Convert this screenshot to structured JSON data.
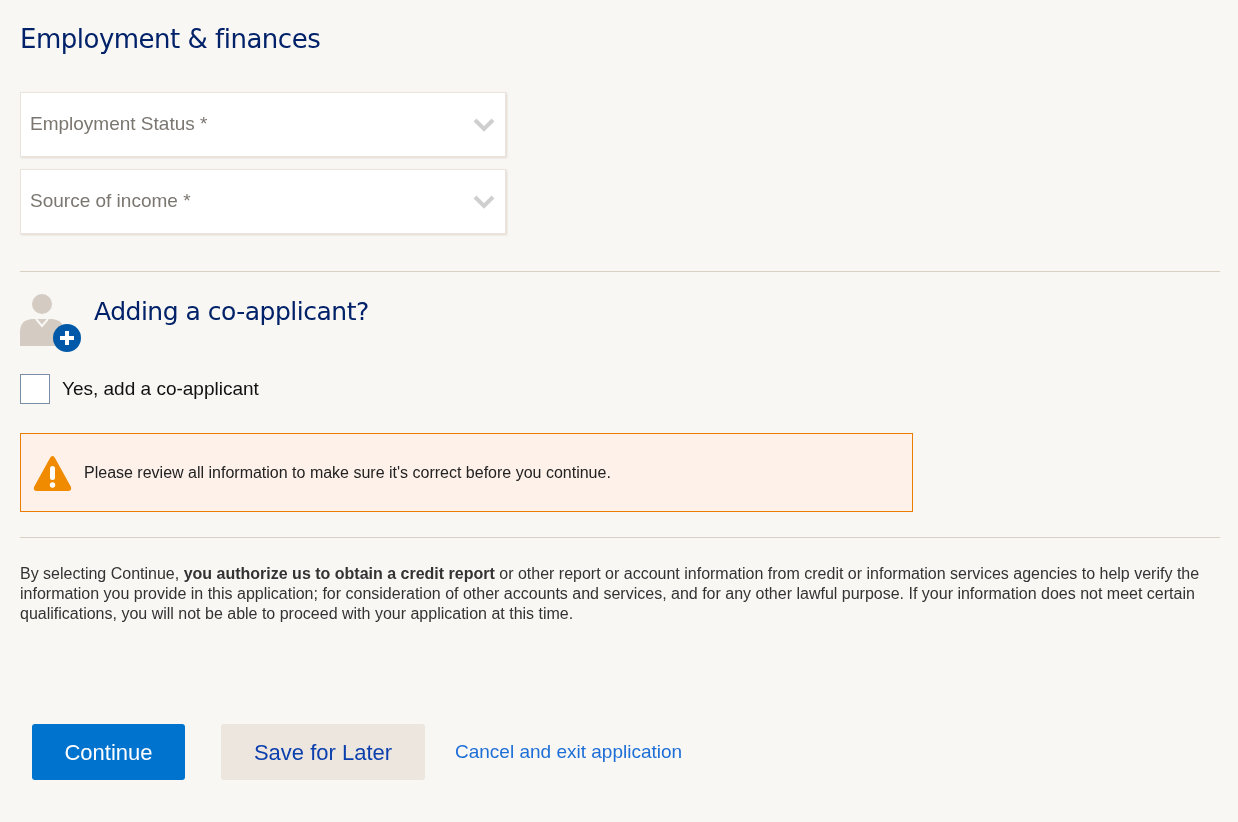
{
  "heading": "Employment & finances",
  "selects": [
    {
      "placeholder": "Employment Status *"
    },
    {
      "placeholder": "Source of income *"
    }
  ],
  "co_applicant": {
    "heading": "Adding a co-applicant?",
    "checkbox": {
      "label": "Yes, add a co-applicant",
      "checked": false
    }
  },
  "alert": {
    "message": "Please review all information to make sure it's correct before you continue."
  },
  "disclaimer": "By selecting Continue, **you authorize us to obtain a credit report** or other report or account information from credit or information services agencies to help verify the information you provide in this application; for consideration of other accounts and services, and for any other lawful purpose. If your information does not meet certain qualifications, you will not be able to proceed with your application at this time.",
  "buttons": [
    {
      "kind": "primary",
      "label": "Continue"
    },
    {
      "kind": "secondary",
      "label": "Save for Later"
    },
    {
      "kind": "link",
      "label": "Cancel and exit application"
    }
  ]
}
